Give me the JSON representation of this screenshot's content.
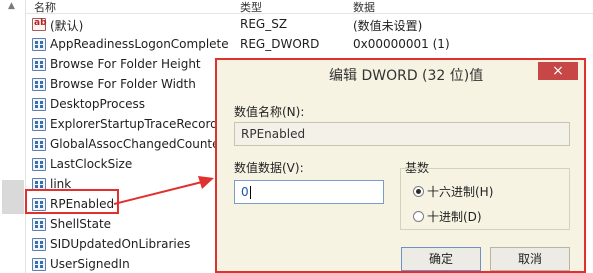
{
  "header": {
    "name": "名称",
    "type": "类型",
    "data": "数据"
  },
  "rows": [
    {
      "name": "(默认)",
      "type": "REG_SZ",
      "data": "(数值未设置)",
      "icon": "string-value-icon"
    },
    {
      "name": "AppReadinessLogonComplete",
      "type": "REG_DWORD",
      "data": "0x00000001 (1)",
      "icon": "binary-value-icon"
    },
    {
      "name": "Browse For Folder Height",
      "type": "",
      "data": "",
      "icon": "binary-value-icon"
    },
    {
      "name": "Browse For Folder Width",
      "type": "",
      "data": "",
      "icon": "binary-value-icon"
    },
    {
      "name": "DesktopProcess",
      "type": "",
      "data": "",
      "icon": "binary-value-icon"
    },
    {
      "name": "ExplorerStartupTraceRecorded",
      "type": "",
      "data": "",
      "icon": "binary-value-icon"
    },
    {
      "name": "GlobalAssocChangedCounter",
      "type": "",
      "data": "",
      "icon": "binary-value-icon"
    },
    {
      "name": "LastClockSize",
      "type": "",
      "data": "",
      "icon": "binary-value-icon"
    },
    {
      "name": "link",
      "type": "",
      "data": "",
      "icon": "binary-value-icon"
    },
    {
      "name": "RPEnabled",
      "type": "",
      "data": "",
      "icon": "binary-value-icon"
    },
    {
      "name": "ShellState",
      "type": "",
      "data": "",
      "icon": "binary-value-icon"
    },
    {
      "name": "SIDUpdatedOnLibraries",
      "type": "",
      "data": "",
      "icon": "binary-value-icon"
    },
    {
      "name": "UserSignedIn",
      "type": "",
      "data": "",
      "icon": "binary-value-icon"
    }
  ],
  "dialog": {
    "title": "编辑 DWORD (32 位)值",
    "close": "×",
    "value_name_label": "数值名称(N):",
    "value_name": "RPEnabled",
    "value_data_label": "数值数据(V):",
    "value_data": "0",
    "base_label": "基数",
    "hex_label": "十六进制(H)",
    "dec_label": "十进制(D)",
    "selected_base": "hex",
    "ok": "确定",
    "cancel": "取消"
  },
  "colors": {
    "highlight": "#e0312e",
    "dialog_bg": "#f7f3e3",
    "close_button": "#c74646"
  }
}
